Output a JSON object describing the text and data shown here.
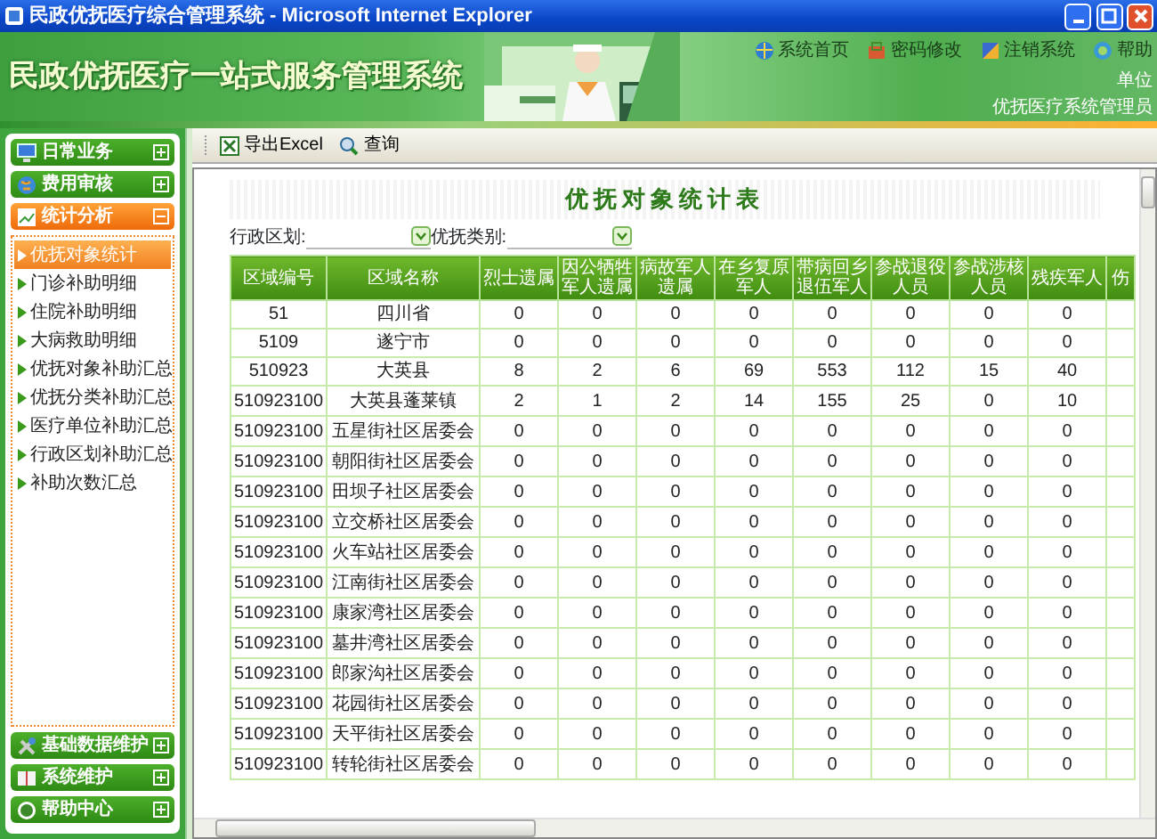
{
  "window": {
    "title": "民政优抚医疗综合管理系统 - Microsoft Internet Explorer"
  },
  "header": {
    "system_title": "民政优抚医疗一站式服务管理系统",
    "links": [
      {
        "label": "系统首页"
      },
      {
        "label": "密码修改"
      },
      {
        "label": "注销系统"
      },
      {
        "label": "帮助"
      }
    ],
    "unit_label": "单位",
    "user": "优抚医疗系统管理员"
  },
  "sidebar": {
    "groups": [
      {
        "label": "日常业务",
        "expanded": false
      },
      {
        "label": "费用审核",
        "expanded": false
      },
      {
        "label": "统计分析",
        "expanded": true,
        "items": [
          {
            "label": "优抚对象统计",
            "selected": true
          },
          {
            "label": "门诊补助明细",
            "selected": false
          },
          {
            "label": "住院补助明细",
            "selected": false
          },
          {
            "label": "大病救助明细",
            "selected": false
          },
          {
            "label": "优抚对象补助汇总",
            "selected": false
          },
          {
            "label": "优抚分类补助汇总",
            "selected": false
          },
          {
            "label": "医疗单位补助汇总",
            "selected": false
          },
          {
            "label": "行政区划补助汇总",
            "selected": false
          },
          {
            "label": "补助次数汇总",
            "selected": false
          }
        ]
      },
      {
        "label": "基础数据维护",
        "expanded": false
      },
      {
        "label": "系统维护",
        "expanded": false
      },
      {
        "label": "帮助中心",
        "expanded": false
      }
    ]
  },
  "toolbar": {
    "buttons": [
      {
        "label": "导出Excel"
      },
      {
        "label": "查询"
      }
    ]
  },
  "report": {
    "title": "优抚对象统计表",
    "filters": [
      {
        "label": "行政区划:"
      },
      {
        "label": "优抚类别:"
      }
    ],
    "table": {
      "columns": [
        "区域编号",
        "区域名称",
        "烈士遗属",
        "因公牺牲军人遗属",
        "病故军人遗属",
        "在乡复原军人",
        "带病回乡退伍军人",
        "参战退役人员",
        "参战涉核人员",
        "残疾军人",
        "伤"
      ],
      "rows": [
        [
          "51",
          "四川省",
          "0",
          "0",
          "0",
          "0",
          "0",
          "0",
          "0",
          "0"
        ],
        [
          "5109",
          "遂宁市",
          "0",
          "0",
          "0",
          "0",
          "0",
          "0",
          "0",
          "0"
        ],
        [
          "510923",
          "大英县",
          "8",
          "2",
          "6",
          "69",
          "553",
          "112",
          "15",
          "40"
        ],
        [
          "510923100",
          "大英县蓬莱镇",
          "2",
          "1",
          "2",
          "14",
          "155",
          "25",
          "0",
          "10"
        ],
        [
          "510923100",
          "五星街社区居委会",
          "0",
          "0",
          "0",
          "0",
          "0",
          "0",
          "0",
          "0"
        ],
        [
          "510923100",
          "朝阳街社区居委会",
          "0",
          "0",
          "0",
          "0",
          "0",
          "0",
          "0",
          "0"
        ],
        [
          "510923100",
          "田坝子社区居委会",
          "0",
          "0",
          "0",
          "0",
          "0",
          "0",
          "0",
          "0"
        ],
        [
          "510923100",
          "立交桥社区居委会",
          "0",
          "0",
          "0",
          "0",
          "0",
          "0",
          "0",
          "0"
        ],
        [
          "510923100",
          "火车站社区居委会",
          "0",
          "0",
          "0",
          "0",
          "0",
          "0",
          "0",
          "0"
        ],
        [
          "510923100",
          "江南街社区居委会",
          "0",
          "0",
          "0",
          "0",
          "0",
          "0",
          "0",
          "0"
        ],
        [
          "510923100",
          "康家湾社区居委会",
          "0",
          "0",
          "0",
          "0",
          "0",
          "0",
          "0",
          "0"
        ],
        [
          "510923100",
          "墓井湾社区居委会",
          "0",
          "0",
          "0",
          "0",
          "0",
          "0",
          "0",
          "0"
        ],
        [
          "510923100",
          "郎家沟社区居委会",
          "0",
          "0",
          "0",
          "0",
          "0",
          "0",
          "0",
          "0"
        ],
        [
          "510923100",
          "花园街社区居委会",
          "0",
          "0",
          "0",
          "0",
          "0",
          "0",
          "0",
          "0"
        ],
        [
          "510923100",
          "天平街社区居委会",
          "0",
          "0",
          "0",
          "0",
          "0",
          "0",
          "0",
          "0"
        ],
        [
          "510923100",
          "转轮街社区居委会",
          "0",
          "0",
          "0",
          "0",
          "0",
          "0",
          "0",
          "0"
        ]
      ]
    }
  }
}
